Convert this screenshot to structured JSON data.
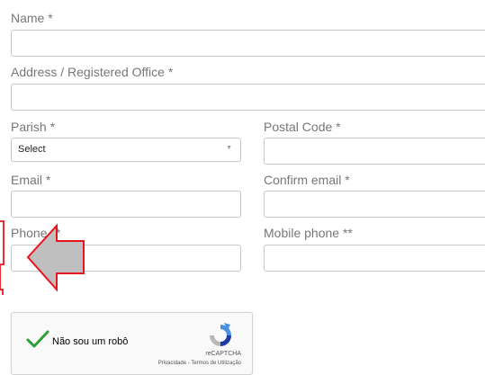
{
  "form": {
    "name_label": "Name *",
    "address_label": "Address / Registered Office *",
    "parish_label": "Parish *",
    "parish_value": "Select",
    "postal_label": "Postal Code *",
    "email_label": "Email *",
    "confirm_email_label": "Confirm email *",
    "phone_label": "Phone **",
    "mobile_label": "Mobile phone **"
  },
  "captcha": {
    "label": "Não sou um robô",
    "brand": "reCAPTCHA",
    "privacy": "Privacidade",
    "separator": " - ",
    "terms": "Termos de Utilização"
  },
  "colors": {
    "annotation_red": "#e8141c",
    "arrow_fill": "#bfbfbf",
    "check_green": "#2e9e3c"
  }
}
